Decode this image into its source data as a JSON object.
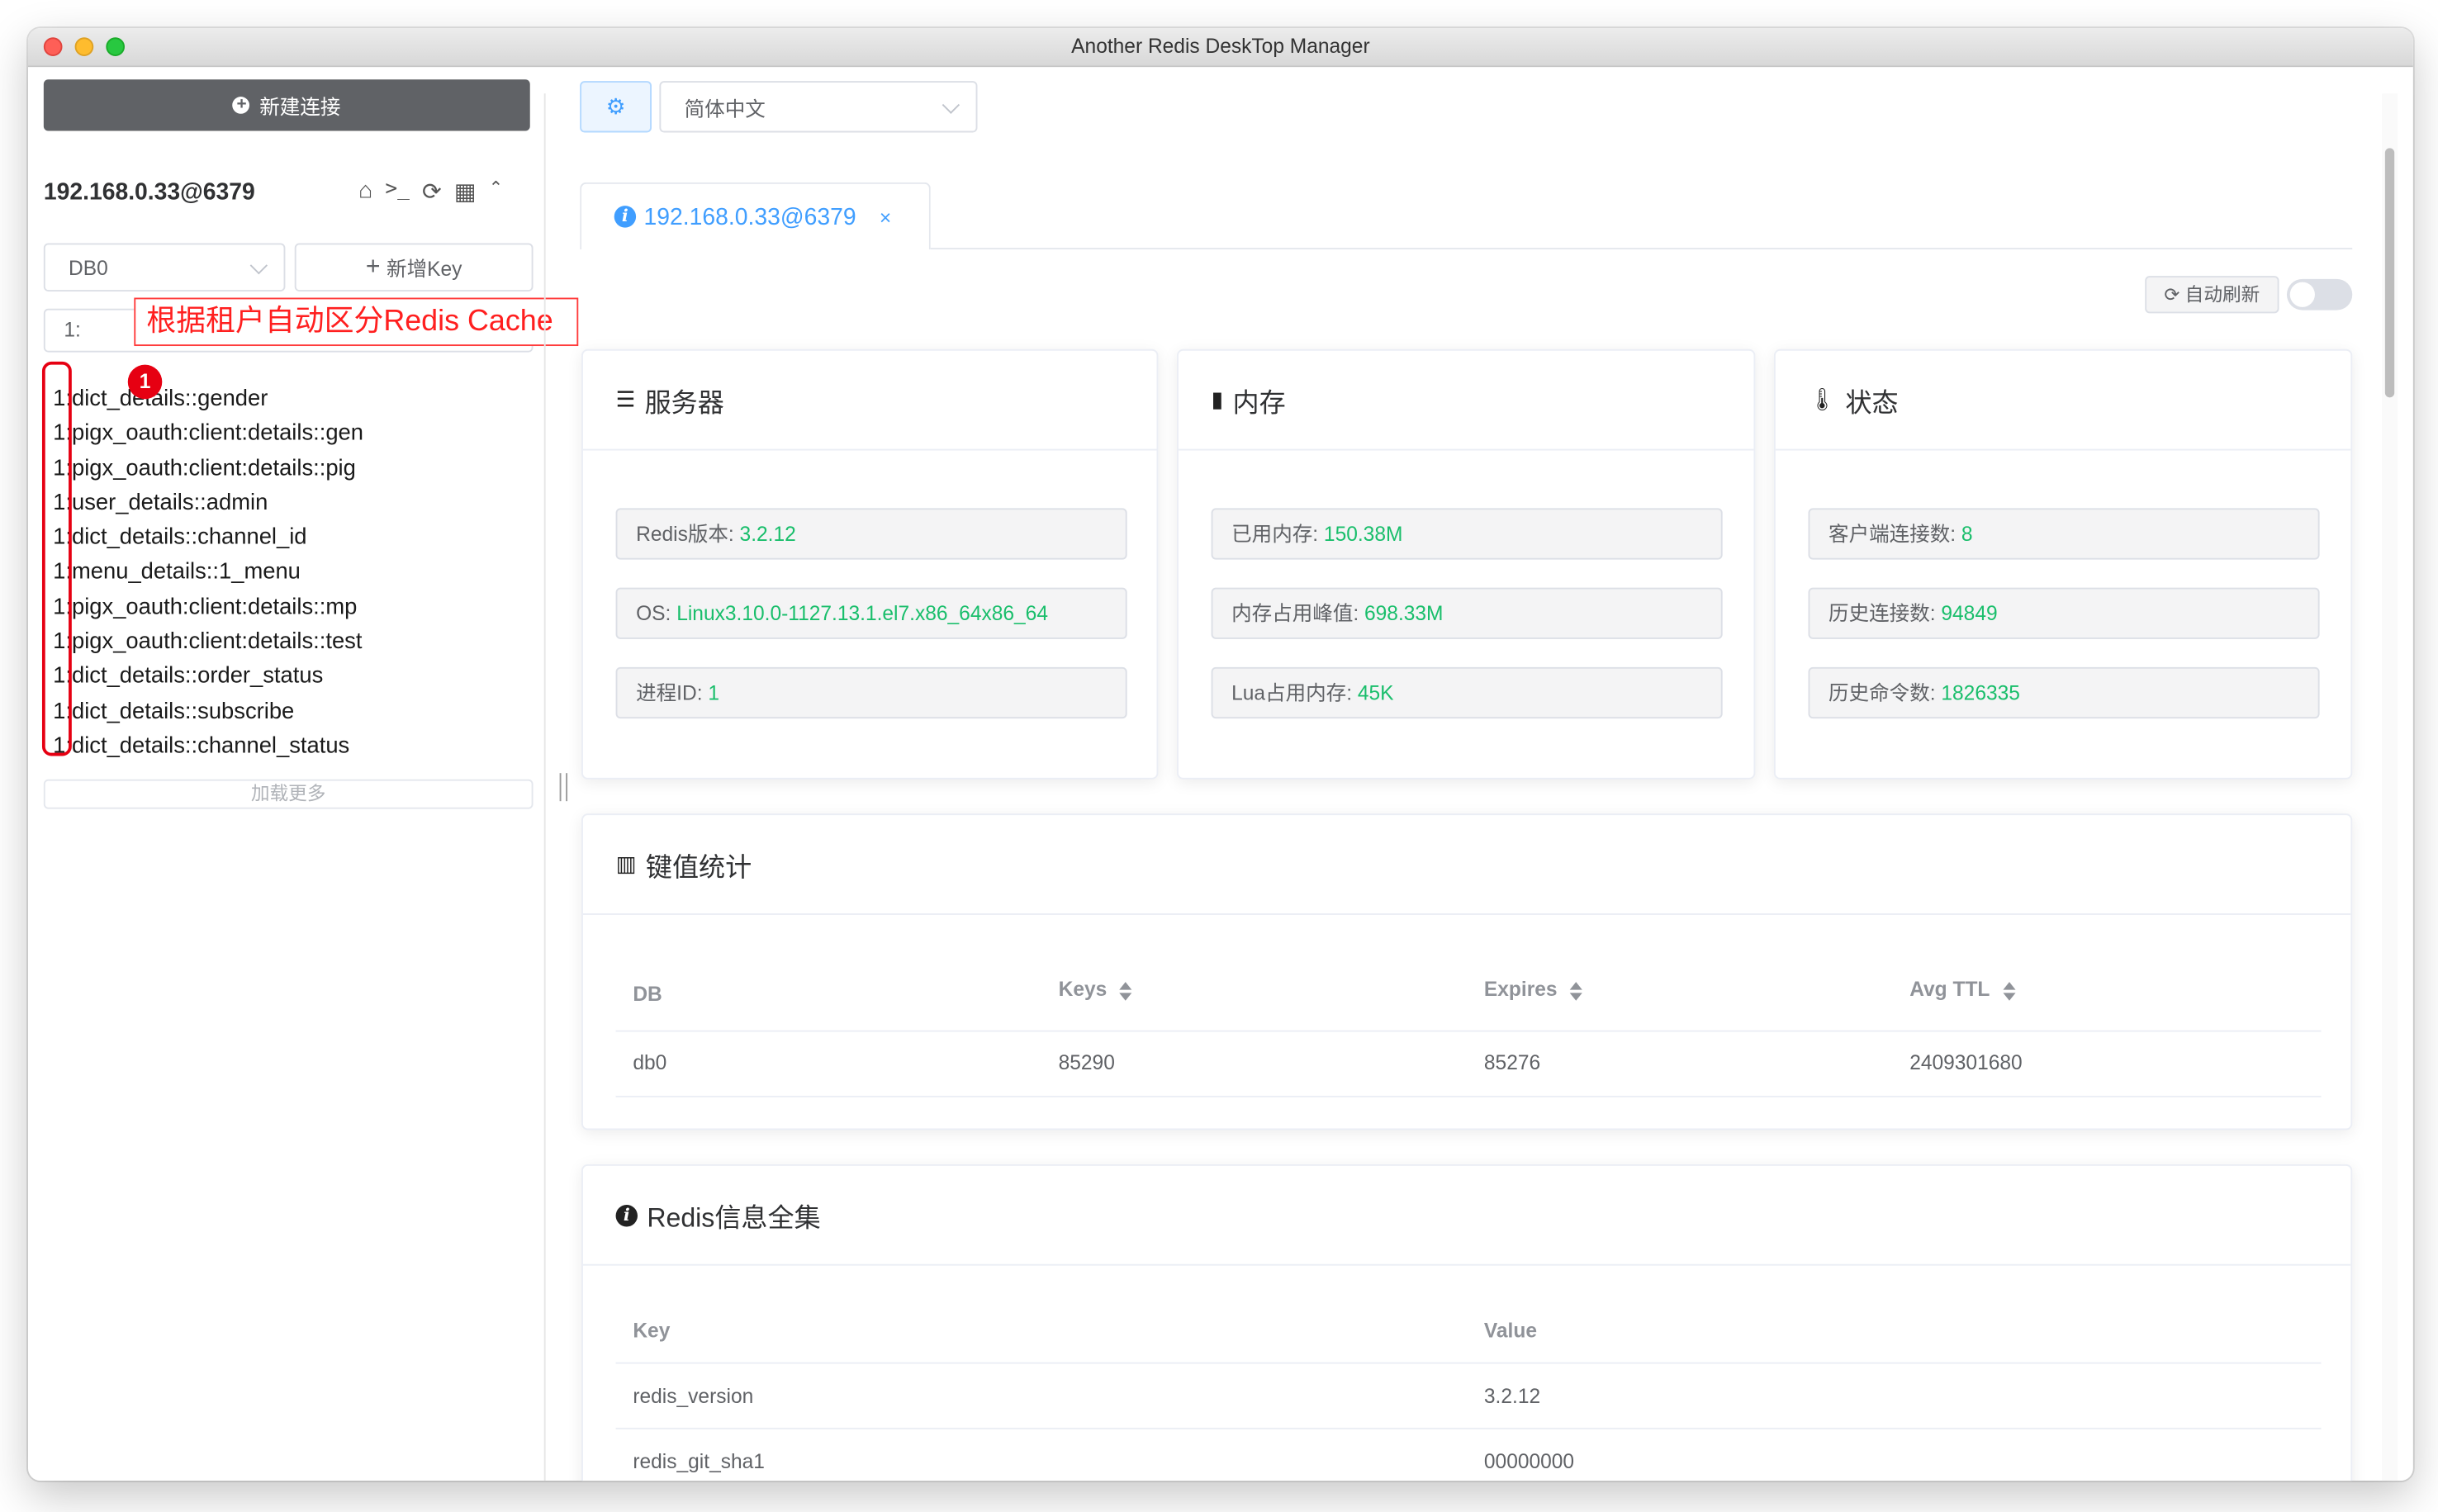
{
  "window": {
    "title": "Another Redis DeskTop Manager"
  },
  "sidebar": {
    "new_connection_label": "新建连接",
    "connection_name": "192.168.0.33@6379",
    "db_select": "DB0",
    "add_key_label": "新增Key",
    "filter_value": "1:",
    "keys": [
      "1:dict_details::gender",
      "1:pigx_oauth:client:details::gen",
      "1:pigx_oauth:client:details::pig",
      "1:user_details::admin",
      "1:dict_details::channel_id",
      "1:menu_details::1_menu",
      "1:pigx_oauth:client:details::mp",
      "1:pigx_oauth:client:details::test",
      "1:dict_details::order_status",
      "1:dict_details::subscribe",
      "1:dict_details::channel_status"
    ],
    "load_more_label": "加载更多"
  },
  "annotation": {
    "text": "根据租户自动区分Redis Cache",
    "badge": "1"
  },
  "toolbar": {
    "language": "简体中文"
  },
  "tab": {
    "label": "192.168.0.33@6379",
    "close": "×"
  },
  "auto_refresh_label": "自动刷新",
  "server_card": {
    "title": "服务器",
    "items": [
      {
        "label": "Redis版本: ",
        "value": "3.2.12"
      },
      {
        "label": "OS: ",
        "value": "Linux3.10.0-1127.13.1.el7.x86_64x86_64"
      },
      {
        "label": "进程ID: ",
        "value": "1"
      }
    ]
  },
  "memory_card": {
    "title": "内存",
    "items": [
      {
        "label": "已用内存: ",
        "value": "150.38M"
      },
      {
        "label": "内存占用峰值: ",
        "value": "698.33M"
      },
      {
        "label": "Lua占用内存: ",
        "value": "45K"
      }
    ]
  },
  "status_card": {
    "title": "状态",
    "items": [
      {
        "label": "客户端连接数: ",
        "value": "8"
      },
      {
        "label": "历史连接数: ",
        "value": "94849"
      },
      {
        "label": "历史命令数: ",
        "value": "1826335"
      }
    ]
  },
  "keyspace": {
    "title": "键值统计",
    "headers": [
      "DB",
      "Keys",
      "Expires",
      "Avg TTL"
    ],
    "rows": [
      [
        "db0",
        "85290",
        "85276",
        "2409301680"
      ]
    ]
  },
  "info": {
    "title": "Redis信息全集",
    "headers": [
      "Key",
      "Value"
    ],
    "rows": [
      [
        "redis_version",
        "3.2.12"
      ],
      [
        "redis_git_sha1",
        "00000000"
      ]
    ]
  },
  "colors": {
    "accent": "#409eff",
    "value_green": "#19be6b",
    "annotation_red": "#e60012"
  }
}
